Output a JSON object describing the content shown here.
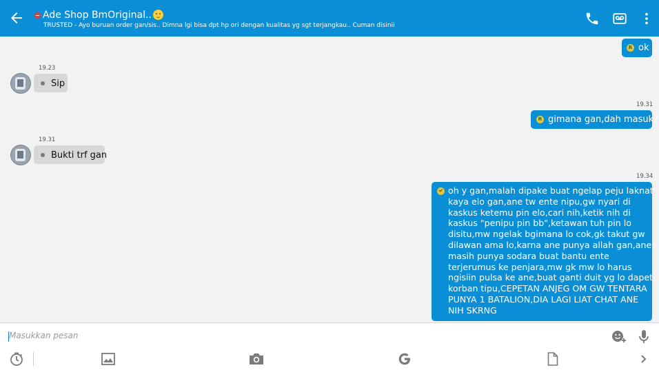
{
  "header": {
    "contact_name": "Ade Shop BmOriginal..",
    "status_message": "TRUSTED - Ayo buruan order gan/sis.. Dimna lgi bisa dpt hp ori dengan kualitas yg sgt terjangkau.. Cuman disinii",
    "icons": [
      "back-arrow-icon",
      "dnd-status-icon",
      "emoji-icon",
      "phone-icon",
      "voicemail-icon",
      "more-vert-icon"
    ]
  },
  "messages": [
    {
      "direction": "out",
      "time": "",
      "text": "ok",
      "badge": "R"
    },
    {
      "direction": "in",
      "time": "19.23",
      "text": "Sip"
    },
    {
      "direction": "out",
      "time": "19.31",
      "text": "gimana gan,dah masuk?",
      "badge": "R"
    },
    {
      "direction": "in",
      "time": "19.31",
      "text": "Bukti trf gan"
    },
    {
      "direction": "out",
      "time": "19.34",
      "text": "oh y gan,malah dipake buat ngelap peju laknat kaya elo gan,ane tw ente nipu,gw nyari di kaskus ketemu pin elo,cari nih,ketik nih di kaskus \"penipu pin bb\",ketawan tuh pin lo disitu,mw ngelak bgimana lo cok,gk takut gw dilawan ama lo,karna ane punya allah gan,ane masih punya sodara buat bantu ente terjerumus ke penjara,mw gk mw lo harus ngisiin pulsa ke ane,buat ganti duit yg lo dapet korban tipu,CEPETAN ANJEG OM GW TENTARA PUNYA 1 BATALION,DIA LAGI LIAT CHAT ANE NIH SKRNG",
      "badge": "check"
    }
  ],
  "composer": {
    "placeholder": "Masukkan pesan",
    "icons": [
      "emoji-add-icon",
      "mic-icon",
      "timer-icon",
      "gallery-icon",
      "camera-icon",
      "google-icon",
      "file-icon",
      "chevron-right-icon"
    ]
  },
  "colors": {
    "accent": "#0a8fd6",
    "incoming_bubble": "#d8d8d8",
    "background": "#f2f2f2"
  }
}
